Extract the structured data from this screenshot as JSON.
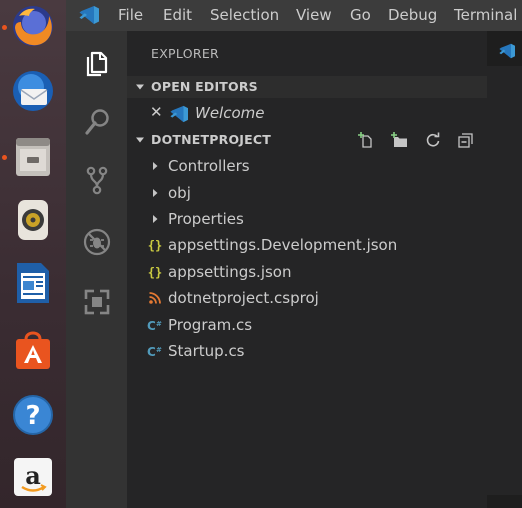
{
  "dock": {
    "apps": [
      {
        "name": "Firefox",
        "icon": "firefox-icon",
        "running": true
      },
      {
        "name": "Thunderbird",
        "icon": "thunderbird-icon",
        "running": false
      },
      {
        "name": "Files",
        "icon": "files-icon",
        "running": true
      },
      {
        "name": "Rhythmbox",
        "icon": "rhythmbox-icon",
        "running": false
      },
      {
        "name": "LibreOffice Writer",
        "icon": "writer-icon",
        "running": false
      },
      {
        "name": "Ubuntu Software",
        "icon": "software-center-icon",
        "running": false
      },
      {
        "name": "Help",
        "icon": "help-icon",
        "running": false
      },
      {
        "name": "Amazon",
        "icon": "amazon-icon",
        "running": false
      }
    ]
  },
  "menubar": {
    "items": [
      "File",
      "Edit",
      "Selection",
      "View",
      "Go",
      "Debug",
      "Terminal"
    ]
  },
  "activity_bar": {
    "icons": [
      "files-icon",
      "search-icon",
      "source-control-icon",
      "debug-icon",
      "extensions-icon"
    ]
  },
  "sidebar": {
    "title": "EXPLORER",
    "open_editors": {
      "header": "OPEN EDITORS",
      "items": [
        {
          "label": "Welcome",
          "icon": "vscode-icon"
        }
      ]
    },
    "project": {
      "header": "DOTNETPROJECT",
      "actions": [
        "new-file-icon",
        "new-folder-icon",
        "refresh-icon",
        "collapse-all-icon"
      ],
      "items": [
        {
          "label": "Controllers",
          "kind": "folder"
        },
        {
          "label": "obj",
          "kind": "folder"
        },
        {
          "label": "Properties",
          "kind": "folder"
        },
        {
          "label": "appsettings.Development.json",
          "kind": "json"
        },
        {
          "label": "appsettings.json",
          "kind": "json"
        },
        {
          "label": "dotnetproject.csproj",
          "kind": "rss"
        },
        {
          "label": "Program.cs",
          "kind": "csharp"
        },
        {
          "label": "Startup.cs",
          "kind": "csharp"
        }
      ]
    }
  },
  "colors": {
    "vscode_blue": "#3c99d4",
    "json_yellow": "#cbcb41",
    "rss_orange": "#e37933",
    "csharp_blue": "#519aba",
    "running_dot": "#e9541f"
  }
}
